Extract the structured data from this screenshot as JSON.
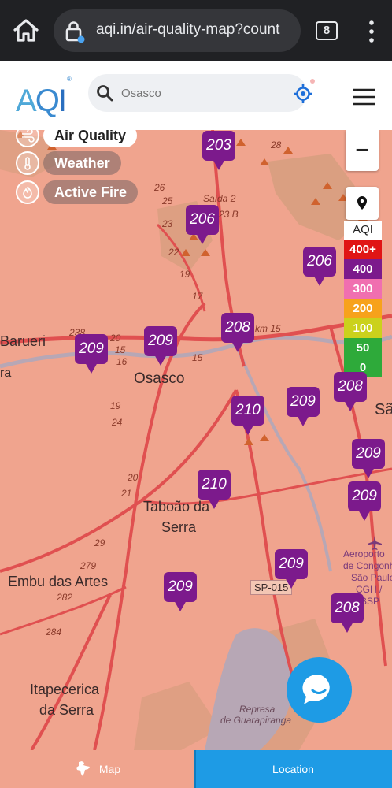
{
  "browser": {
    "url": "aqi.in/air-quality-map?count",
    "tab_count": "8"
  },
  "header": {
    "logo_text": "AQI",
    "search_value": "Osasco"
  },
  "layers": [
    {
      "label": "Air Quality",
      "active": true
    },
    {
      "label": "Weather",
      "active": false
    },
    {
      "label": "Active Fire",
      "active": false
    }
  ],
  "controls": {
    "zoom_out_label": "−"
  },
  "legend": {
    "title": "AQI",
    "items": [
      {
        "label": "400+",
        "color": "#e01515"
      },
      {
        "label": "400",
        "color": "#7c1a8c"
      },
      {
        "label": "300",
        "color": "#f06fb0"
      },
      {
        "label": "200",
        "color": "#f7a21b"
      },
      {
        "label": "100",
        "color": "#cbd11c"
      },
      {
        "label": "50",
        "color": "#2eaa3a"
      },
      {
        "label": "0",
        "color": "#2eaa3a"
      }
    ]
  },
  "markers": [
    {
      "value": "203"
    },
    {
      "value": "206"
    },
    {
      "value": "206"
    },
    {
      "value": "208"
    },
    {
      "value": "209"
    },
    {
      "value": "209"
    },
    {
      "value": "208"
    },
    {
      "value": "209"
    },
    {
      "value": "210"
    },
    {
      "value": "209"
    },
    {
      "value": "210"
    },
    {
      "value": "209"
    },
    {
      "value": "209"
    },
    {
      "value": "209"
    },
    {
      "value": "208"
    }
  ],
  "map_labels": {
    "barueri": "Barueri",
    "osasco": "Osasco",
    "taboao_1": "Taboão da",
    "taboao_2": "Serra",
    "embu": "Embu das Artes",
    "itapecerica_1": "Itapecerica",
    "itapecerica_2": "da Serra",
    "sa": "Sã",
    "ra": "ra",
    "sp015": "SP-015",
    "represa_1": "Represa",
    "represa_2": "de Guarapiranga",
    "aero_1": "Aeroporto",
    "aero_2": "de Congonha",
    "aero_3": "São Paulo",
    "aero_4": "CGH /",
    "aero_5": "BSP",
    "saida": "Saída 2",
    "saida23": "23 B",
    "km15": "km 15",
    "r28": "28",
    "r26": "26",
    "r25": "25",
    "r23": "23",
    "r22": "22",
    "r19": "19",
    "r17": "17",
    "r238": "238",
    "r20": "20",
    "r15": "15",
    "r16": "16",
    "r15b": "15",
    "r19b": "19",
    "r24": "24",
    "r20b": "20",
    "r21": "21",
    "r29": "29",
    "r279": "279",
    "r282": "282",
    "r284": "284"
  },
  "bottom_tabs": {
    "map": "Map",
    "location": "Location"
  }
}
